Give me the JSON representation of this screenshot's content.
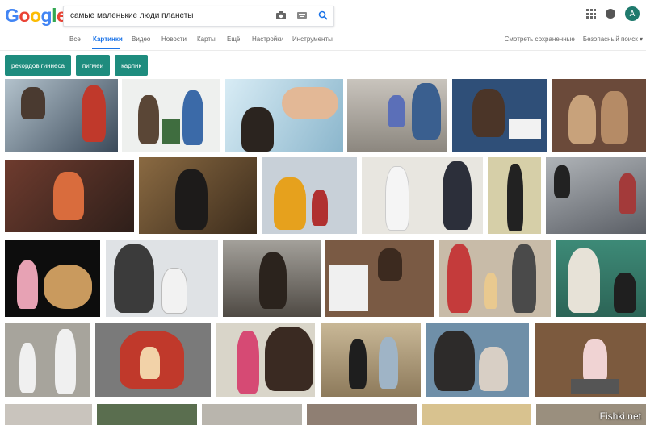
{
  "header": {
    "logo": "Google",
    "search_value": "самые маленькие люди планеты",
    "avatar_letter": "A"
  },
  "tabs": {
    "items": [
      "Все",
      "Картинки",
      "Видео",
      "Новости",
      "Карты",
      "Ещё",
      "Настройки",
      "Инструменты"
    ],
    "active": "Картинки",
    "right": [
      "Смотреть сохраненные",
      "Безопасный поиск ▾"
    ]
  },
  "chips": [
    "рекордов гиннеса",
    "пигмеи",
    "карлик"
  ],
  "watermark": "Fishki.net",
  "colors": {
    "accent": "#1a73e8",
    "chip": "#1e8c7e",
    "logo": [
      "#4285f4",
      "#ea4335",
      "#fbbc05",
      "#4285f4",
      "#34a853",
      "#ea4335"
    ]
  }
}
